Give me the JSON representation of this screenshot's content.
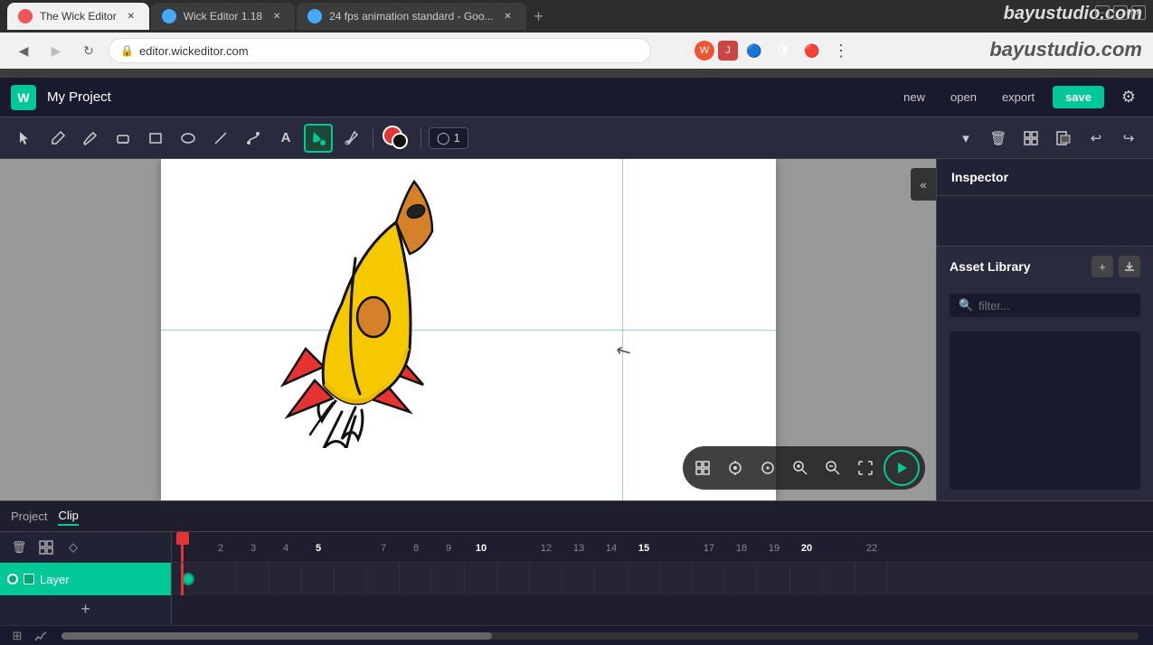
{
  "browser": {
    "tabs": [
      {
        "id": "tab1",
        "favicon_color": "#e55",
        "label": "The Wick Editor",
        "active": true
      },
      {
        "id": "tab2",
        "favicon_color": "#4af",
        "label": "Wick Editor 1.18",
        "active": false
      },
      {
        "id": "tab3",
        "favicon_color": "#4af",
        "label": "24 fps animation standard - Goo...",
        "active": false
      }
    ],
    "new_tab_label": "+",
    "back_icon": "◀",
    "forward_icon": "▶",
    "reload_icon": "↻",
    "address": "editor.wickeditor.com",
    "lock_icon": "🔒",
    "watermark": "bayustudio.com"
  },
  "header": {
    "logo_text": "W",
    "project_name": "My Project",
    "new_label": "new",
    "open_label": "open",
    "export_label": "export",
    "save_label": "save",
    "settings_icon": "⚙"
  },
  "toolbar": {
    "tools": [
      {
        "id": "select",
        "icon": "✥",
        "active": false
      },
      {
        "id": "brush-stroke",
        "icon": "✏",
        "active": false
      },
      {
        "id": "pencil",
        "icon": "✐",
        "active": false
      },
      {
        "id": "eraser",
        "icon": "◻",
        "active": false
      },
      {
        "id": "rect",
        "icon": "▭",
        "active": false
      },
      {
        "id": "ellipse",
        "icon": "○",
        "active": false
      },
      {
        "id": "line",
        "icon": "╱",
        "active": false
      },
      {
        "id": "path",
        "icon": "⌘",
        "active": false
      },
      {
        "id": "text",
        "icon": "A",
        "active": false
      },
      {
        "id": "fill",
        "icon": "◆",
        "active": true
      },
      {
        "id": "eyedropper",
        "icon": "🖊",
        "active": false
      }
    ],
    "fill_color": "#e53333",
    "stroke_color": "#111111",
    "onion_icon": "◯",
    "onion_value": "1",
    "dropdown_icon": "▾",
    "delete_icon": "🗑",
    "group_icon": "⊞",
    "clip_icon": "◧",
    "undo_icon": "↩",
    "redo_icon": "↪"
  },
  "canvas": {
    "collapse_icon": "«",
    "controls": [
      {
        "id": "grid",
        "icon": "⊞"
      },
      {
        "id": "recenter",
        "icon": "⊕"
      },
      {
        "id": "origin",
        "icon": "⊙"
      },
      {
        "id": "zoom-in",
        "icon": "🔍"
      },
      {
        "id": "zoom-out",
        "icon": "⊖"
      },
      {
        "id": "fullscreen",
        "icon": "⛶"
      }
    ],
    "play_icon": "▶"
  },
  "inspector": {
    "title": "Inspector"
  },
  "asset_library": {
    "title": "Asset Library",
    "add_icon": "+",
    "export_icon": "↑",
    "search_icon": "🔍",
    "search_placeholder": "filter..."
  },
  "timeline": {
    "tabs": [
      {
        "id": "project",
        "label": "Project",
        "active": false
      },
      {
        "id": "clip",
        "label": "Clip",
        "active": true
      }
    ],
    "controls": [
      {
        "id": "delete",
        "icon": "🗑"
      },
      {
        "id": "add-frame",
        "icon": "⊞"
      },
      {
        "id": "diamond",
        "icon": "◇"
      }
    ],
    "layer_name": "Layer",
    "frame_numbers": [
      "",
      "2",
      "3",
      "4",
      "5",
      "",
      "7",
      "8",
      "9",
      "10",
      "",
      "12",
      "13",
      "14",
      "15",
      "",
      "17",
      "18",
      "19",
      "20",
      "",
      "22",
      "2"
    ],
    "highlighted_frames": [
      5,
      10,
      15,
      20
    ],
    "add_layer_icon": "+",
    "bottom_icons": [
      "⊞",
      "⌃"
    ]
  }
}
